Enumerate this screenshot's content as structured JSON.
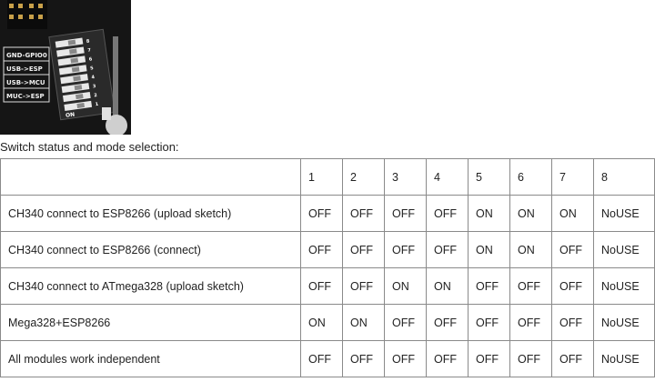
{
  "photo": {
    "labels": [
      "GND-GPIO0",
      "USB->ESP",
      "USB->MCU",
      "MUC->ESP"
    ],
    "dip_on_label": "ON",
    "dip_numbers": [
      "1",
      "2",
      "3",
      "4",
      "5",
      "6",
      "7",
      "8"
    ]
  },
  "caption": "Switch status and mode selection:",
  "table": {
    "header": [
      "",
      "1",
      "2",
      "3",
      "4",
      "5",
      "6",
      "7",
      "8"
    ],
    "rows": [
      [
        "CH340 connect to ESP8266 (upload sketch)",
        "OFF",
        "OFF",
        "OFF",
        "OFF",
        "ON",
        "ON",
        "ON",
        "NoUSE"
      ],
      [
        "CH340 connect to ESP8266 (connect)",
        "OFF",
        "OFF",
        "OFF",
        "OFF",
        "ON",
        "ON",
        "OFF",
        "NoUSE"
      ],
      [
        "CH340 connect to ATmega328 (upload sketch)",
        "OFF",
        "OFF",
        "ON",
        "ON",
        "OFF",
        "OFF",
        "OFF",
        "NoUSE"
      ],
      [
        "Mega328+ESP8266",
        "ON",
        "ON",
        "OFF",
        "OFF",
        "OFF",
        "OFF",
        "OFF",
        "NoUSE"
      ],
      [
        "All modules work independent",
        "OFF",
        "OFF",
        "OFF",
        "OFF",
        "OFF",
        "OFF",
        "OFF",
        "NoUSE"
      ]
    ]
  }
}
